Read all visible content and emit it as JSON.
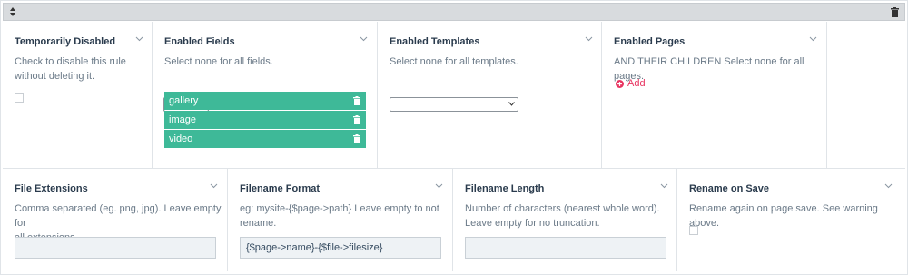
{
  "topbar": {
    "sort_icon": "sort-arrows-icon",
    "trash_icon": "trash-icon"
  },
  "row1": {
    "temporarily_disabled": {
      "title": "Temporarily Disabled",
      "desc_line1": "Check to disable this rule",
      "desc_line2": "without deleting it."
    },
    "enabled_fields": {
      "title": "Enabled Fields",
      "desc": "Select none for all fields.",
      "selected_value": "",
      "items": [
        {
          "label": "gallery"
        },
        {
          "label": "image"
        },
        {
          "label": "video"
        }
      ]
    },
    "enabled_templates": {
      "title": "Enabled Templates",
      "desc": "Select none for all templates.",
      "selected_value": ""
    },
    "enabled_pages": {
      "title": "Enabled Pages",
      "desc": "AND THEIR CHILDREN Select none for all pages.",
      "add_label": "Add"
    }
  },
  "row2": {
    "file_extensions": {
      "title": "File Extensions",
      "desc_line1": "Comma separated (eg. png, jpg). Leave empty for",
      "desc_line2": "all extensions.",
      "value": ""
    },
    "filename_format": {
      "title": "Filename Format",
      "desc_line1": "eg: mysite-{$page->path} Leave empty to not",
      "desc_line2": "rename.",
      "value": "{$page->name}-{$file->filesize}"
    },
    "filename_length": {
      "title": "Filename Length",
      "desc_line1": "Number of characters (nearest whole word).",
      "desc_line2": "Leave empty for no truncation.",
      "value": ""
    },
    "rename_on_save": {
      "title": "Rename on Save",
      "desc": "Rename again on page save. See warning above."
    }
  },
  "colors": {
    "tag_bg": "#3eb998",
    "add_link": "#e83561",
    "topbar_bg": "#d8dbde"
  }
}
